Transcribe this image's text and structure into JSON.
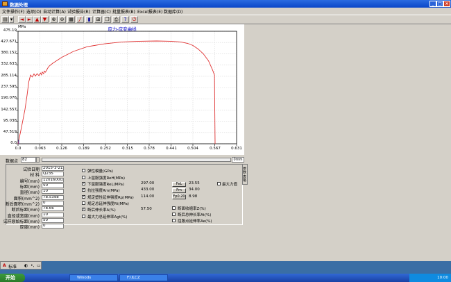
{
  "window": {
    "title": "数据处理"
  },
  "menu": [
    "文件操作(F)",
    "选项(O)",
    "自动计算(A)",
    "试验报告(R)",
    "计算器(C)",
    "批量报表(B)",
    "Excel报表(E)",
    "数据库(D)"
  ],
  "toolbar": {
    "icons": [
      "chart-type-icon",
      "dropdown-icon",
      "arrow-left-icon",
      "arrow-right-icon",
      "arrow-up-icon",
      "arrow-down-icon",
      "zoom-in-icon",
      "zoom-out-icon",
      "table-icon",
      "line-icon",
      "bar-icon",
      "grid-icon",
      "copy-icon",
      "print-icon",
      "help-icon",
      "exit-icon"
    ],
    "glyphs": [
      "▤",
      "▾",
      "◄",
      "►",
      "▲",
      "▼",
      "⊕",
      "⊖",
      "▦",
      "╱",
      "▮",
      "⊞",
      "❐",
      "⎙",
      "?",
      "⏻"
    ]
  },
  "chart_data": {
    "type": "line",
    "title": "应力-应变曲线",
    "ylabel": "MPa",
    "xlabel": "",
    "xlim": [
      0,
      0.631
    ],
    "ylim": [
      0,
      475.19
    ],
    "x_ticks": [
      "0.0",
      "0.063",
      "0.126",
      "0.189",
      "0.252",
      "0.315",
      "0.378",
      "0.441",
      "0.504",
      "0.567",
      "0.631"
    ],
    "y_ticks": [
      "0.0",
      "47.519",
      "95.038",
      "142.557",
      "190.076",
      "237.595",
      "285.114",
      "332.633",
      "380.152",
      "427.671",
      "475.19"
    ],
    "color": "#e03030",
    "series": [
      {
        "x": [
          0,
          0.01,
          0.02,
          0.026,
          0.031,
          0.036,
          0.041,
          0.046,
          0.05,
          0.055,
          0.06,
          0.065,
          0.068,
          0.07,
          0.074,
          0.076,
          0.079,
          0.083,
          0.086,
          0.09,
          0.1,
          0.126,
          0.16,
          0.2,
          0.25,
          0.3,
          0.35,
          0.4,
          0.44,
          0.47,
          0.49,
          0.505,
          0.52,
          0.535,
          0.55,
          0.562,
          0.567,
          0.569
        ],
        "y": [
          0,
          70,
          145,
          205,
          262,
          290,
          282,
          295,
          286,
          296,
          288,
          299,
          291,
          303,
          296,
          307,
          302,
          312,
          320,
          328,
          340,
          365,
          390,
          410,
          422,
          430,
          433,
          434,
          433,
          430,
          424,
          415,
          400,
          380,
          350,
          310,
          290,
          0
        ]
      }
    ]
  },
  "probe": {
    "label": "数据点",
    "value": "82",
    "readout": "0mm"
  },
  "specimen": {
    "fields": [
      {
        "label": "试验日期",
        "value": "2015-3-21"
      },
      {
        "label": "材    料",
        "value": "Q235"
      },
      {
        "label": "编号(mm)",
        "value": "1201600022"
      },
      {
        "label": "标距(mm)",
        "value": "50"
      },
      {
        "label": "直径(mm)",
        "value": "10"
      },
      {
        "label": "面积(mm^2)",
        "value": "78.5398"
      },
      {
        "label": "断后面积(mm^2)",
        "value": "0"
      },
      {
        "label": "断后标距(mm)",
        "value": "78.66"
      },
      {
        "label": "直径或宽度(mm)",
        "value": "10"
      },
      {
        "label": "试样原始标距(mm)",
        "value": "50"
      },
      {
        "label": "厚度(mm)",
        "value": "0"
      }
    ]
  },
  "results": {
    "left_items": [
      {
        "label": "弹性模量(GPa)",
        "checked": false,
        "value": ""
      },
      {
        "label": "上屈服强度ReH(MPa)",
        "checked": false,
        "value": ""
      },
      {
        "label": "下屈服强度ReL(MPa)",
        "checked": true,
        "value": "297.00"
      },
      {
        "label": "抗拉强度Rm(MPa)",
        "checked": true,
        "value": "433.00"
      },
      {
        "label": "规定塑性延伸强度Rp(MPa)",
        "checked": true,
        "value": "114.00"
      },
      {
        "label": "规定总延伸强度Rt(MPa)",
        "checked": false,
        "value": ""
      },
      {
        "label": "断后伸长率A(%)",
        "checked": true,
        "value": "57.50"
      },
      {
        "label": "最大力总延伸率Agt(%)",
        "checked": false,
        "value": ""
      }
    ],
    "force_buttons": [
      {
        "label": "FeL",
        "value": "23.55"
      },
      {
        "label": "Fm",
        "value": "34.00"
      },
      {
        "label": "Fp0.20",
        "value": "8.98"
      }
    ],
    "max_force": {
      "label": "最大力值",
      "checked": false
    },
    "right_items": [
      {
        "label": "断面收缩率Z(%)",
        "checked": false
      },
      {
        "label": "断后总伸长率At(%)",
        "checked": false
      },
      {
        "label": "屈服点延伸率Ae(%)",
        "checked": false
      }
    ],
    "tab": "参数 表格"
  },
  "ime": {
    "lang": "A",
    "mode": "标准"
  },
  "taskbar": {
    "start": "开始",
    "tasks": [
      "Winods",
      "F:\\ILCZ"
    ],
    "clock": "10:00"
  }
}
